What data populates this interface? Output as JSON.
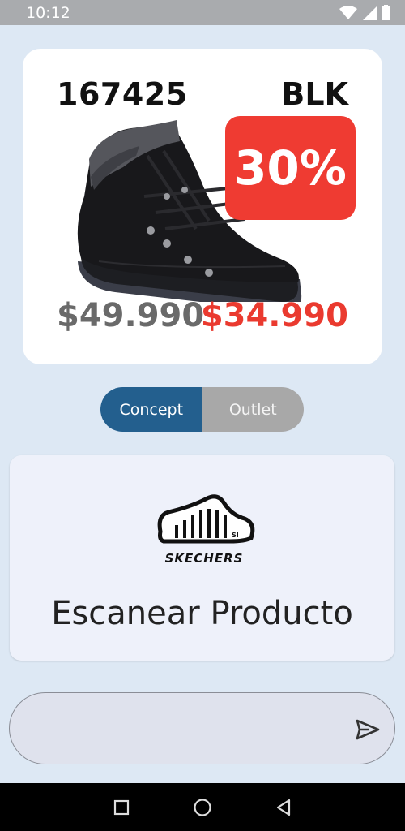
{
  "status_bar": {
    "time": "10:12",
    "icons": [
      "wifi-icon",
      "signal-icon",
      "battery-icon"
    ]
  },
  "product": {
    "sku": "167425",
    "color_code": "BLK",
    "discount": "30%",
    "price_original": "$49.990",
    "price_sale": "$34.990",
    "image_icon": "boot-image"
  },
  "store_toggle": {
    "options": [
      "Concept",
      "Outlet"
    ],
    "selected": "Concept"
  },
  "scan_card": {
    "brand": "SKECHERS",
    "title": "Escanear Producto"
  },
  "input": {
    "value": "",
    "placeholder": ""
  },
  "nav": {
    "buttons": [
      "recents-square-icon",
      "home-circle-icon",
      "back-triangle-icon"
    ]
  },
  "colors": {
    "background": "#dde8f4",
    "accent_blue": "#235f8e",
    "sale_red": "#ea3a2f",
    "inactive_gray": "#a8a8a8"
  }
}
